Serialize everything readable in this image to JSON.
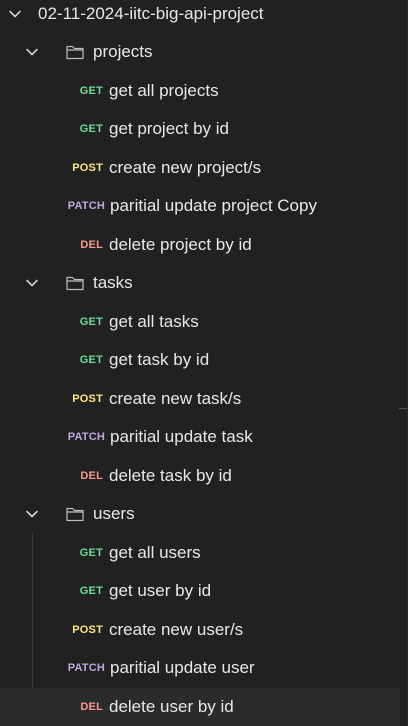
{
  "collection": {
    "name": "02-11-2024-iitc-big-api-project",
    "folders": [
      {
        "name": "projects",
        "requests": [
          {
            "method": "GET",
            "name": "get all projects"
          },
          {
            "method": "GET",
            "name": "get project by id"
          },
          {
            "method": "POST",
            "name": "create new project/s"
          },
          {
            "method": "PATCH",
            "name": "paritial update project Copy"
          },
          {
            "method": "DEL",
            "name": "delete project by id"
          }
        ]
      },
      {
        "name": "tasks",
        "requests": [
          {
            "method": "GET",
            "name": "get all tasks"
          },
          {
            "method": "GET",
            "name": "get task by id"
          },
          {
            "method": "POST",
            "name": "create new task/s"
          },
          {
            "method": "PATCH",
            "name": "paritial update task"
          },
          {
            "method": "DEL",
            "name": "delete task by id"
          }
        ]
      },
      {
        "name": "users",
        "requests": [
          {
            "method": "GET",
            "name": "get all users"
          },
          {
            "method": "GET",
            "name": "get user by id"
          },
          {
            "method": "POST",
            "name": "create new user/s"
          },
          {
            "method": "PATCH",
            "name": "paritial update user"
          },
          {
            "method": "DEL",
            "name": "delete user by id"
          }
        ]
      }
    ]
  },
  "colors": {
    "background": "#212121",
    "selected_row": "#2b2b2b",
    "text": "#e8e8e8",
    "get": "#6bdd9a",
    "post": "#ffe47e",
    "patch": "#c0a8e1",
    "del": "#f79a8e"
  },
  "icons": {
    "expand": "chevron-down-icon",
    "folder": "folder-icon"
  },
  "selected_request": "delete user by id"
}
